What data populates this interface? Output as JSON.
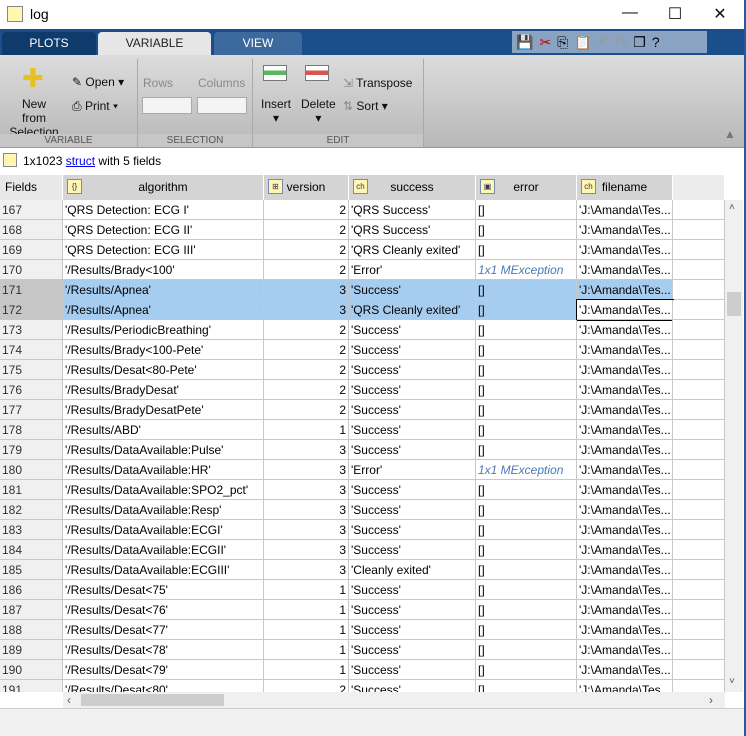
{
  "window": {
    "title": "log",
    "minimize": "—",
    "maximize": "☐",
    "close": "✕"
  },
  "tabs": [
    {
      "label": "PLOTS"
    },
    {
      "label": "VARIABLE"
    },
    {
      "label": "VIEW"
    }
  ],
  "ribbon": {
    "new_from": "New from",
    "selection": "Selection ▾",
    "open": "Open ▾",
    "print": "Print ▾",
    "rows": "Rows",
    "columns": "Columns",
    "insert": "Insert",
    "delete": "Delete",
    "transpose": "Transpose",
    "sort": "Sort ▾",
    "groups": [
      "VARIABLE",
      "SELECTION",
      "EDIT"
    ]
  },
  "info": {
    "size": "1x1023",
    "type_link": "struct",
    "suffix": "with 5 fields"
  },
  "columns": [
    "Fields",
    "algorithm",
    "version",
    "success",
    "error",
    "filename"
  ],
  "rows": [
    [
      "167",
      "'QRS Detection: ECG I'",
      "2",
      "'QRS Success'",
      "[]",
      "'J:\\Amanda\\Tes..."
    ],
    [
      "168",
      "'QRS Detection: ECG II'",
      "2",
      "'QRS Success'",
      "[]",
      "'J:\\Amanda\\Tes..."
    ],
    [
      "169",
      "'QRS Detection: ECG III'",
      "2",
      "'QRS Cleanly exited'",
      "[]",
      "'J:\\Amanda\\Tes..."
    ],
    [
      "170",
      "'/Results/Brady<100'",
      "2",
      "'Error'",
      "1x1 MException",
      "'J:\\Amanda\\Tes..."
    ],
    [
      "171",
      "'/Results/Apnea'",
      "3",
      "'Success'",
      "[]",
      "'J:\\Amanda\\Tes..."
    ],
    [
      "172",
      "'/Results/Apnea'",
      "3",
      "'QRS Cleanly exited'",
      "[]",
      "'J:\\Amanda\\Tes..."
    ],
    [
      "173",
      "'/Results/PeriodicBreathing'",
      "2",
      "'Success'",
      "[]",
      "'J:\\Amanda\\Tes..."
    ],
    [
      "174",
      "'/Results/Brady<100-Pete'",
      "2",
      "'Success'",
      "[]",
      "'J:\\Amanda\\Tes..."
    ],
    [
      "175",
      "'/Results/Desat<80-Pete'",
      "2",
      "'Success'",
      "[]",
      "'J:\\Amanda\\Tes..."
    ],
    [
      "176",
      "'/Results/BradyDesat'",
      "2",
      "'Success'",
      "[]",
      "'J:\\Amanda\\Tes..."
    ],
    [
      "177",
      "'/Results/BradyDesatPete'",
      "2",
      "'Success'",
      "[]",
      "'J:\\Amanda\\Tes..."
    ],
    [
      "178",
      "'/Results/ABD'",
      "1",
      "'Success'",
      "[]",
      "'J:\\Amanda\\Tes..."
    ],
    [
      "179",
      "'/Results/DataAvailable:Pulse'",
      "3",
      "'Success'",
      "[]",
      "'J:\\Amanda\\Tes..."
    ],
    [
      "180",
      "'/Results/DataAvailable:HR'",
      "3",
      "'Error'",
      "1x1 MException",
      "'J:\\Amanda\\Tes..."
    ],
    [
      "181",
      "'/Results/DataAvailable:SPO2_pct'",
      "3",
      "'Success'",
      "[]",
      "'J:\\Amanda\\Tes..."
    ],
    [
      "182",
      "'/Results/DataAvailable:Resp'",
      "3",
      "'Success'",
      "[]",
      "'J:\\Amanda\\Tes..."
    ],
    [
      "183",
      "'/Results/DataAvailable:ECGI'",
      "3",
      "'Success'",
      "[]",
      "'J:\\Amanda\\Tes..."
    ],
    [
      "184",
      "'/Results/DataAvailable:ECGII'",
      "3",
      "'Success'",
      "[]",
      "'J:\\Amanda\\Tes..."
    ],
    [
      "185",
      "'/Results/DataAvailable:ECGIII'",
      "3",
      "'Cleanly exited'",
      "[]",
      "'J:\\Amanda\\Tes..."
    ],
    [
      "186",
      "'/Results/Desat<75'",
      "1",
      "'Success'",
      "[]",
      "'J:\\Amanda\\Tes..."
    ],
    [
      "187",
      "'/Results/Desat<76'",
      "1",
      "'Success'",
      "[]",
      "'J:\\Amanda\\Tes..."
    ],
    [
      "188",
      "'/Results/Desat<77'",
      "1",
      "'Success'",
      "[]",
      "'J:\\Amanda\\Tes..."
    ],
    [
      "189",
      "'/Results/Desat<78'",
      "1",
      "'Success'",
      "[]",
      "'J:\\Amanda\\Tes..."
    ],
    [
      "190",
      "'/Results/Desat<79'",
      "1",
      "'Success'",
      "[]",
      "'J:\\Amanda\\Tes..."
    ],
    [
      "191",
      "'/Results/Desat<80'",
      "2",
      "'Success'",
      "[]",
      "'J:\\Amanda\\Tes..."
    ]
  ],
  "selected_rows": [
    "171",
    "172"
  ],
  "colors": {
    "selection": "#a6cdf0",
    "tabstrip": "#1a4f8c",
    "exception": "#4a7ab8"
  }
}
